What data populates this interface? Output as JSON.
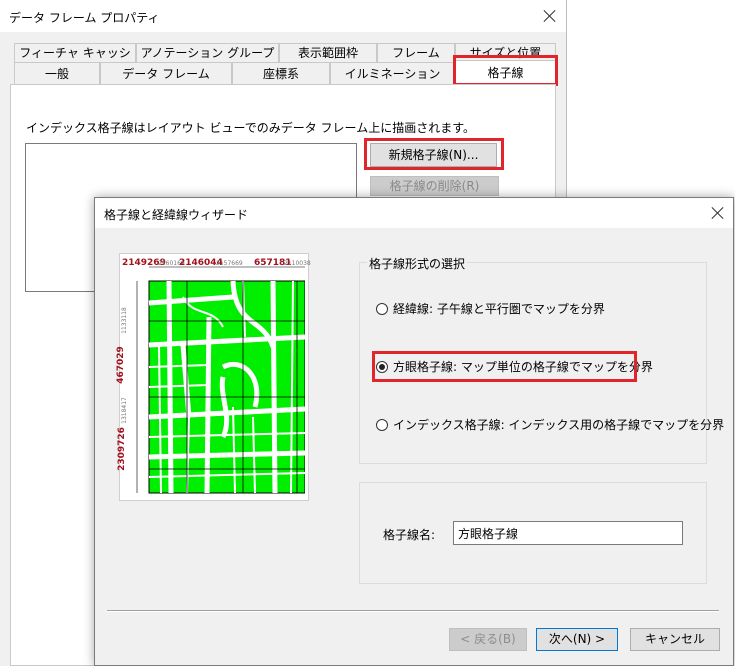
{
  "background_dialog": {
    "title": "データ フレーム プロパティ",
    "tabs_row1": [
      "フィーチャ キャッシュ",
      "アノテーション グループ",
      "表示範囲枠",
      "フレーム",
      "サイズと位置"
    ],
    "tabs_row2": [
      "一般",
      "データ フレーム",
      "座標系",
      "イルミネーション",
      "格子線"
    ],
    "active_tab": "格子線",
    "description": "インデックス格子線はレイアウト ビューでのみデータ フレーム上に描画されます。",
    "new_grid_button": "新規格子線(N)...",
    "delete_grid_button": "格子線の削除(R)"
  },
  "wizard": {
    "title": "格子線と経緯線ウィザード",
    "preview_labels": {
      "top": [
        "2149269",
        "2146044",
        "657181"
      ],
      "top_small": [
        "2160169",
        "2157669",
        "2110038"
      ],
      "left": [
        "467029",
        "2309726"
      ],
      "left_small": [
        "1133118",
        "1318417"
      ]
    },
    "grid_type_group_label": "格子線形式の選択",
    "options": [
      {
        "label": "経緯線: 子午線と平行圏でマップを分界",
        "selected": false
      },
      {
        "label": "方眼格子線: マップ単位の格子線でマップを分界",
        "selected": true
      },
      {
        "label": "インデックス格子線: インデックス用の格子線でマップを分界",
        "selected": false
      }
    ],
    "grid_name_label": "格子線名:",
    "grid_name_value": "方眼格子線",
    "buttons": {
      "back": "< 戻る(B)",
      "next": "次へ(N) >",
      "cancel": "キャンセル"
    }
  },
  "colors": {
    "highlight": "#e0262b",
    "map_fill": "#00ee00",
    "label_red": "#a0121e"
  }
}
